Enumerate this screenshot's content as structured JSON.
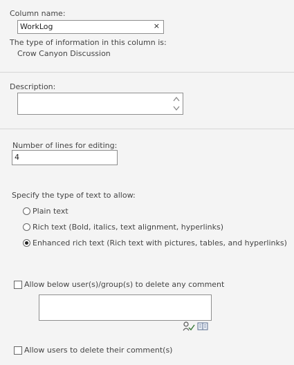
{
  "column_name": {
    "label": "Column name:",
    "value": "WorkLog",
    "clear_icon": "×"
  },
  "type_info": {
    "label": "The type of information in this column is:",
    "value": "Crow Canyon Discussion"
  },
  "description": {
    "label": "Description:",
    "value": ""
  },
  "lines_editing": {
    "label": "Number of lines for editing:",
    "value": "4"
  },
  "text_type": {
    "label": "Specify the type of text to allow:",
    "options": [
      {
        "label": "Plain text",
        "selected": false
      },
      {
        "label": "Rich text (Bold, italics, text alignment, hyperlinks)",
        "selected": false
      },
      {
        "label": "Enhanced rich text (Rich text with pictures, tables, and hyperlinks)",
        "selected": true
      }
    ]
  },
  "delete_comment_groups": {
    "label": "Allow below user(s)/group(s) to delete any comment",
    "checked": false,
    "people_value": "",
    "icons": [
      "check-names-icon",
      "browse-address-book-icon"
    ]
  },
  "delete_own_comment": {
    "label": "Allow users to delete their comment(s)",
    "checked": false
  }
}
